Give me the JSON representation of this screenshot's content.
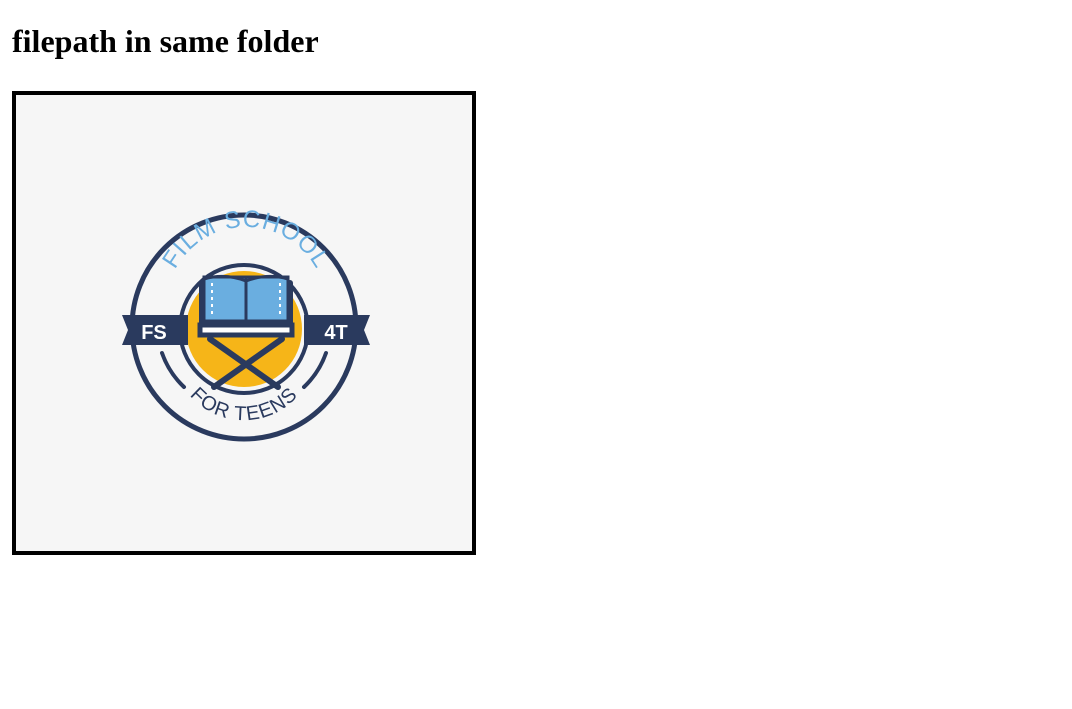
{
  "page": {
    "heading": "filepath in same folder"
  },
  "logo": {
    "text_top": "FILM SCHOOL",
    "text_left": "FS",
    "text_right": "4T",
    "text_bottom": "FOR TEENS",
    "colors": {
      "navy": "#2a3a5e",
      "light_blue": "#6aaee0",
      "gold": "#f6b518",
      "background": "#f6f6f6"
    },
    "icons": [
      "open-book-icon",
      "directors-chair-icon"
    ]
  }
}
